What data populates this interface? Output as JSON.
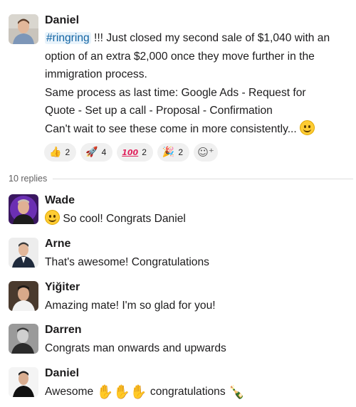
{
  "thread": {
    "parent": {
      "author": "Daniel",
      "channel_tag": "#ringring",
      "line1_rest": " !!! Just closed my second sale of $1,040 with an",
      "line2": "option of an extra $2,000 once they move further in the",
      "line3": "immigration process.",
      "line4": "Same process as last time: Google Ads - Request for",
      "line5": "Quote - Set up a call - Proposal - Confirmation",
      "line6": "Can't wait to see these come in more consistently...",
      "line6_emoji": "smile-emoji",
      "reactions": [
        {
          "icon": "thumbs-up-icon",
          "glyph": "👍",
          "count": "2",
          "color": "#f2a81d"
        },
        {
          "icon": "rocket-icon",
          "glyph": "🚀",
          "count": "4",
          "color": "#d23a3a"
        },
        {
          "icon": "hundred-points-icon",
          "glyph": "100",
          "count": "2",
          "color": "#e0245e"
        },
        {
          "icon": "party-popper-icon",
          "glyph": "🎉",
          "count": "2",
          "color": "#e7a32c"
        }
      ],
      "add_reaction_icon": "add-reaction-icon"
    },
    "replies_label": "10 replies",
    "replies": [
      {
        "author": "Wade",
        "text": "So cool! Congrats Daniel",
        "leading_emoji": "smile-emoji"
      },
      {
        "author": "Arne",
        "text": "That's awesome! Congratulations"
      },
      {
        "author": "Yiğiter",
        "text": "Amazing mate! I'm so glad for you!"
      },
      {
        "author": "Darren",
        "text": "Congrats man onwards and upwards"
      },
      {
        "author": "Daniel",
        "text_before": "Awesome",
        "text_after": "congratulations",
        "emojis": [
          "clapping-hands-icon",
          "clapping-hands-icon",
          "clapping-hands-icon"
        ],
        "trailing_emoji": "champagne-bottle-icon"
      }
    ]
  },
  "colors": {
    "channel_link": "#1264a3",
    "channel_bg": "#e8f3fb",
    "reaction_bg": "#f0f0f0",
    "muted_text": "#616061"
  }
}
